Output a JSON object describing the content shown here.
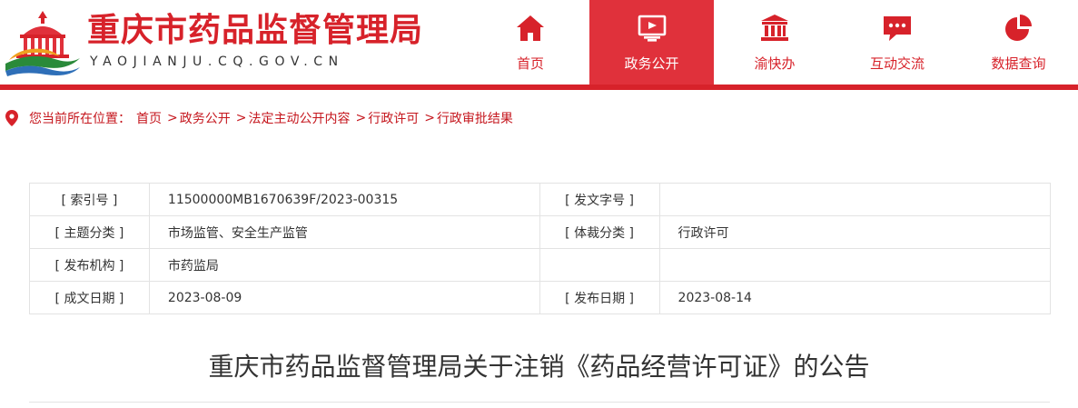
{
  "header": {
    "site_title": "重庆市药品监督管理局",
    "site_domain": "YAOJIANJU.CQ.GOV.CN",
    "brand_color": "#d7222a"
  },
  "nav": {
    "items": [
      {
        "label": "首页",
        "icon": "home-icon",
        "active": false
      },
      {
        "label": "政务公开",
        "icon": "open-gov-icon",
        "active": true
      },
      {
        "label": "渝快办",
        "icon": "government-building-icon",
        "active": false
      },
      {
        "label": "互动交流",
        "icon": "chat-icon",
        "active": false
      },
      {
        "label": "数据查询",
        "icon": "pie-chart-icon",
        "active": false
      }
    ]
  },
  "breadcrumb": {
    "prefix": "您当前所在位置：",
    "items": [
      "首页",
      "政务公开",
      "法定主动公开内容",
      "行政许可",
      "行政审批结果"
    ],
    "separator": ">"
  },
  "meta": {
    "rows": [
      {
        "k1": "[ 索引号 ]",
        "v1": "11500000MB1670639F/2023-00315",
        "k2": "[ 发文字号 ]",
        "v2": ""
      },
      {
        "k1": "[ 主题分类 ]",
        "v1": "市场监管、安全生产监管",
        "k2": "[ 体裁分类 ]",
        "v2": "行政许可"
      },
      {
        "k1": "[ 发布机构 ]",
        "v1": "市药监局",
        "k2": "",
        "v2": ""
      },
      {
        "k1": "[ 成文日期 ]",
        "v1": "2023-08-09",
        "k2": "[ 发布日期 ]",
        "v2": "2023-08-14"
      }
    ]
  },
  "article": {
    "title": "重庆市药品监督管理局关于注销《药品经营许可证》的公告"
  }
}
